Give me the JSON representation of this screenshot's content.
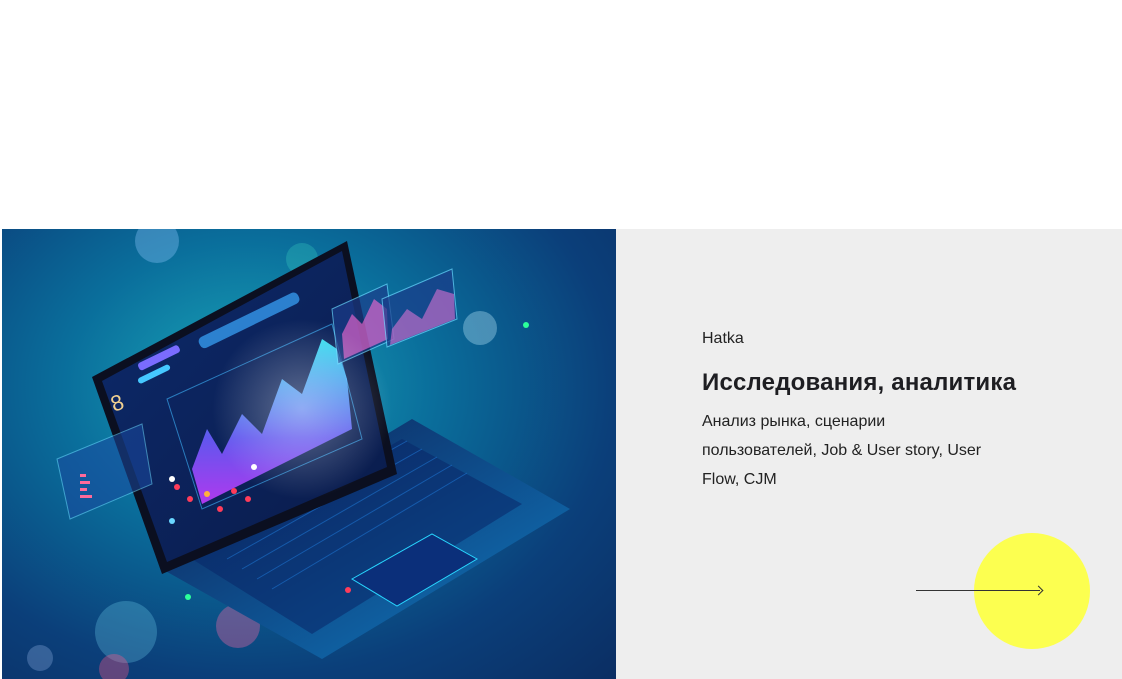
{
  "card": {
    "client": "Hatka",
    "title": "Исследования, аналитика",
    "description": "Анализ рынка, сценарии пользователей, Job & User story, User Flow, CJM",
    "arrow_icon": "arrow-right-icon",
    "accent_color": "#fcff50",
    "panel_color": "#eeeeee"
  }
}
